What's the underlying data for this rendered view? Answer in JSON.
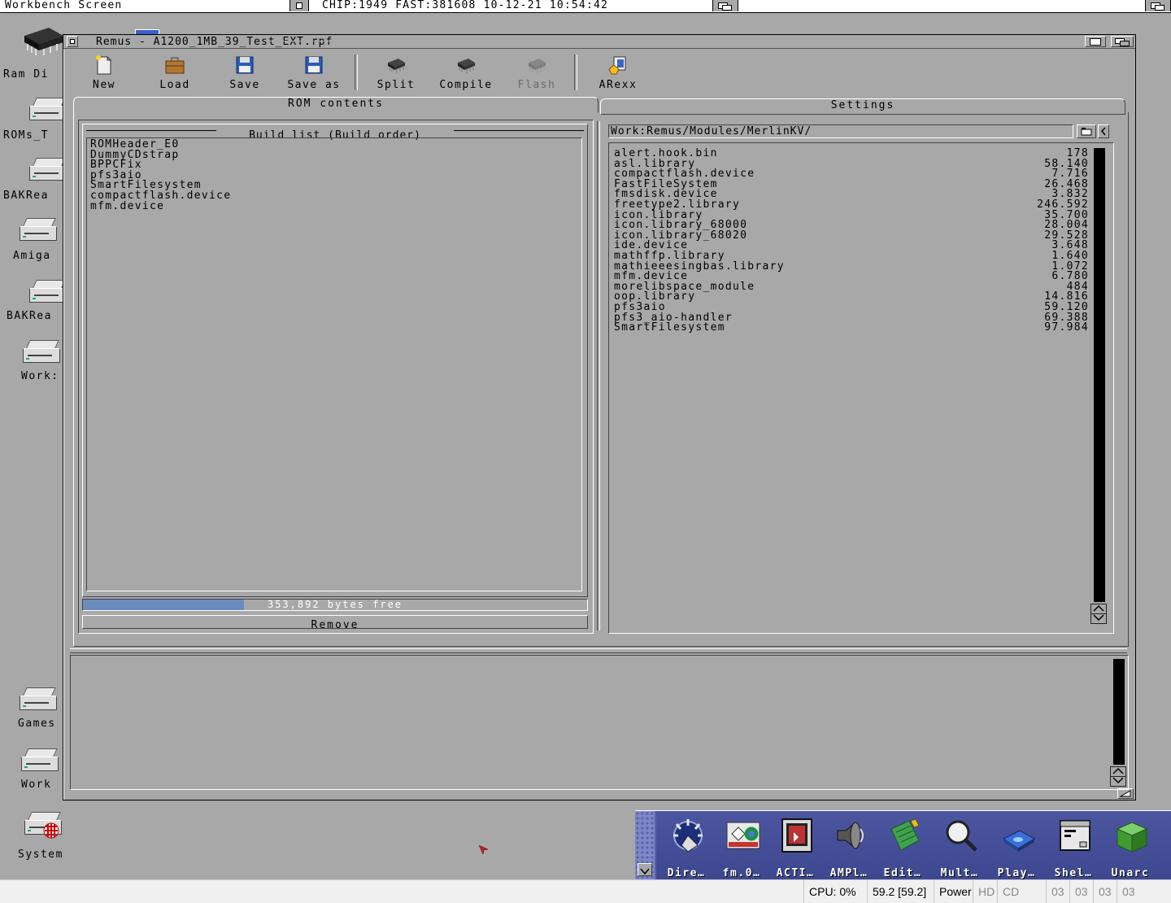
{
  "screen": {
    "title": "Workbench Screen",
    "memory_clock": "CHIP:1949 FAST:381608 10-12-21 10:54:42"
  },
  "desktop_icons": [
    {
      "label": "Ram Di",
      "icon": "ram-chip-icon"
    },
    {
      "label": "ROMs_T",
      "icon": "drive-icon"
    },
    {
      "label": "BAKRea",
      "icon": "drive-icon"
    },
    {
      "label": "Amiga",
      "icon": "drive-icon"
    },
    {
      "label": "BAKRea",
      "icon": "drive-icon"
    },
    {
      "label": "Work:",
      "icon": "drive-icon"
    },
    {
      "label": "Games",
      "icon": "drive-icon"
    },
    {
      "label": "Work",
      "icon": "drive-icon"
    },
    {
      "label": "System",
      "icon": "system-drive-icon"
    }
  ],
  "window": {
    "title": "Remus - A1200_1MB_39_Test_EXT.rpf"
  },
  "toolbar": [
    {
      "label": "New",
      "icon": "new-file-icon",
      "enabled": true
    },
    {
      "label": "Load",
      "icon": "load-briefcase-icon",
      "enabled": true
    },
    {
      "label": "Save",
      "icon": "floppy-save-icon",
      "enabled": true
    },
    {
      "label": "Save as",
      "icon": "floppy-save-as-icon",
      "enabled": true
    },
    {
      "label": "Split",
      "icon": "chip-split-icon",
      "enabled": true
    },
    {
      "label": "Compile",
      "icon": "chip-compile-icon",
      "enabled": true
    },
    {
      "label": "Flash",
      "icon": "chip-flash-icon",
      "enabled": false
    },
    {
      "label": "ARexx",
      "icon": "arexx-icon",
      "enabled": true
    }
  ],
  "tabs": [
    "ROM contents",
    "Settings"
  ],
  "build_list": {
    "header": "Build list (Build order)",
    "items": [
      "ROMHeader_E0",
      "DummyCDstrap",
      "BPPCFix",
      "pfs3aio",
      "SmartFilesystem",
      "compactflash.device",
      "mfm.device"
    ],
    "free_text": "353,892 bytes free",
    "free_fraction": 0.32,
    "remove_label": "Remove"
  },
  "modules": {
    "path": "Work:Remus/Modules/MerlinKV/",
    "items": [
      {
        "name": "alert.hook.bin",
        "size": "178"
      },
      {
        "name": "asl.library",
        "size": "58.140"
      },
      {
        "name": "compactflash.device",
        "size": "7.716"
      },
      {
        "name": "FastFileSystem",
        "size": "26.468"
      },
      {
        "name": "fmsdisk.device",
        "size": "3.832"
      },
      {
        "name": "freetype2.library",
        "size": "246.592"
      },
      {
        "name": "icon.library",
        "size": "35.700"
      },
      {
        "name": "icon.library_68000",
        "size": "28.004"
      },
      {
        "name": "icon.library_68020",
        "size": "29.528"
      },
      {
        "name": "ide.device",
        "size": "3.648"
      },
      {
        "name": "mathffp.library",
        "size": "1.640"
      },
      {
        "name": "mathieeesingbas.library",
        "size": "1.072"
      },
      {
        "name": "mfm.device",
        "size": "6.780"
      },
      {
        "name": "morelibspace_module",
        "size": "484"
      },
      {
        "name": "oop.library",
        "size": "14.816"
      },
      {
        "name": "pfs3aio",
        "size": "59.120"
      },
      {
        "name": "pfs3_aio-handler",
        "size": "69.388"
      },
      {
        "name": "SmartFilesystem",
        "size": "97.984"
      }
    ]
  },
  "dock": [
    {
      "label": "Dire…",
      "icon": "directory-opus-icon"
    },
    {
      "label": "fm.0…",
      "icon": "fm-icon"
    },
    {
      "label": "ACTI…",
      "icon": "activity-icon"
    },
    {
      "label": "AMPl…",
      "icon": "speaker-icon"
    },
    {
      "label": "Edit…",
      "icon": "notepad-pencil-icon"
    },
    {
      "label": "Mult…",
      "icon": "magnifier-icon"
    },
    {
      "label": "Play…",
      "icon": "disk-play-icon"
    },
    {
      "label": "Shel…",
      "icon": "shell-window-icon"
    },
    {
      "label": "Unarc",
      "icon": "archive-cube-icon"
    }
  ],
  "host_status": {
    "cpu": "CPU: 0%",
    "fps": "59.2 [59.2]",
    "power": "Power",
    "hd": "HD",
    "cd": "CD",
    "drives": [
      "03",
      "03",
      "03",
      "03"
    ]
  },
  "colors": {
    "workbench_grey": "#a8a8a8",
    "progress_blue": "#6b8bbf",
    "dock_blue": "#5a63a8",
    "scroll_black": "#000000"
  }
}
